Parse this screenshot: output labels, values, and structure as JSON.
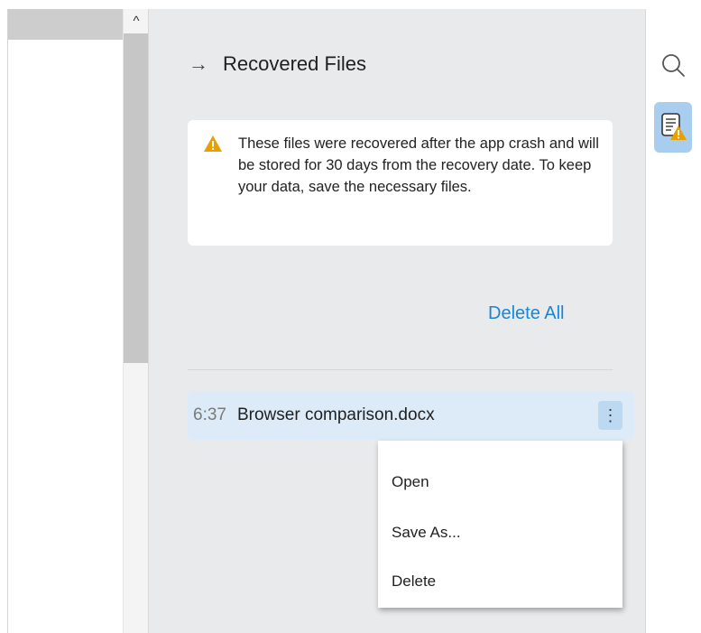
{
  "scroll": {
    "up_glyph": "^",
    "thumb_fraction": 0.53
  },
  "panel": {
    "back_icon": "→",
    "title": "Recovered Files",
    "notice": {
      "icon": "warning-icon",
      "text": "These files were recovered after the app crash and will be stored for 30 days from the recovery date. To keep your data, save the necessary files."
    },
    "delete_all_label": "Delete All",
    "files": [
      {
        "time": "6:37",
        "name": "Browser comparison.docx"
      }
    ],
    "kebab_glyph": "⋮"
  },
  "context_menu": {
    "items": [
      {
        "label": "Open"
      },
      {
        "label": "Save As..."
      },
      {
        "label": "Delete"
      }
    ]
  },
  "rail": {
    "search_icon": "search-icon",
    "recovered_icon": "document-warning-icon"
  },
  "colors": {
    "accent": "#1a86d1",
    "warning": "#e8a000",
    "selected_row": "#dcebf7",
    "rail_active": "#a8cdee"
  }
}
